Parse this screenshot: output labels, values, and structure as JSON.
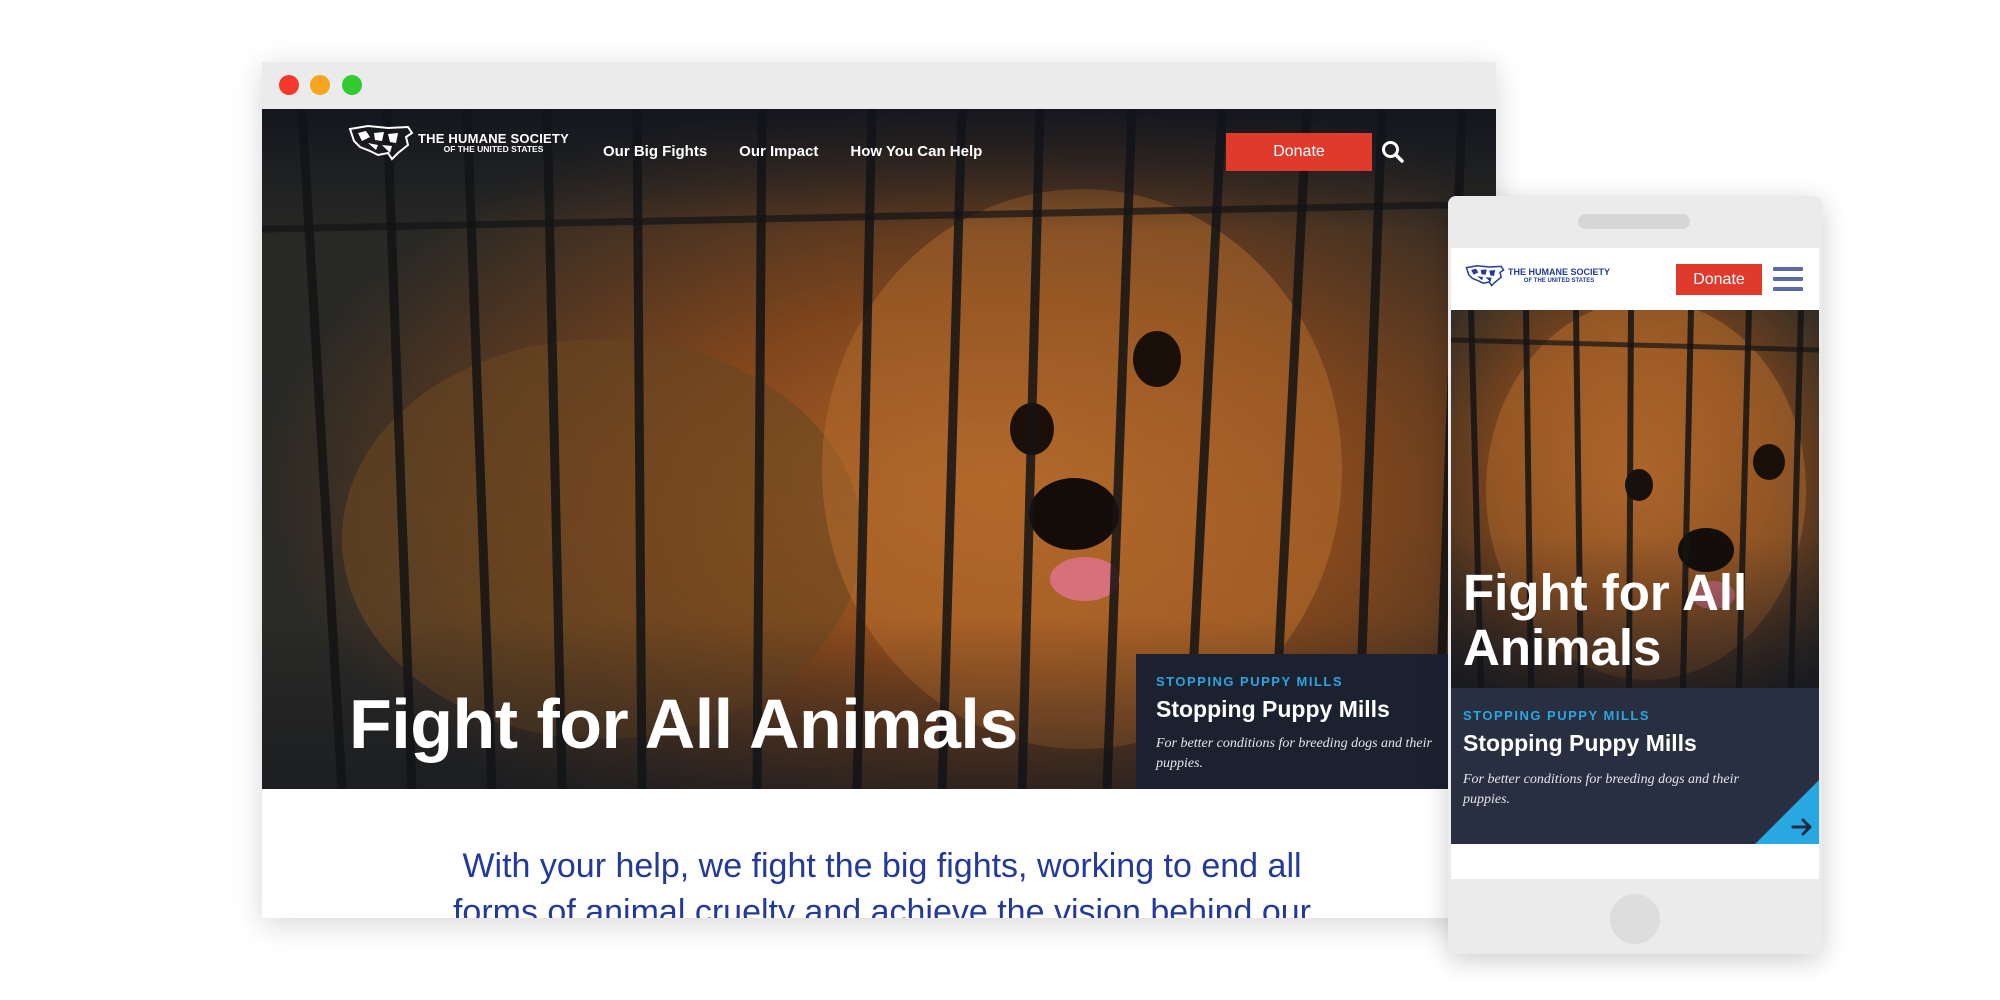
{
  "window_controls": {
    "close": "close",
    "minimize": "minimize",
    "maximize": "maximize"
  },
  "site": {
    "logo_line1": "THE HUMANE SOCIETY",
    "logo_line2": "OF THE UNITED STATES"
  },
  "nav": {
    "links": [
      "Our Big Fights",
      "Our Impact",
      "How You Can Help"
    ],
    "donate_label": "Donate",
    "search_icon": "search-icon"
  },
  "hero": {
    "title": "Fight for All Animals"
  },
  "feature": {
    "eyebrow": "STOPPING PUPPY MILLS",
    "title": "Stopping Puppy Mills",
    "subtitle": "For better conditions for breeding dogs and their puppies."
  },
  "intro": {
    "text": "With your help, we fight the big fights, working to end all forms of animal cruelty and achieve the vision behind our"
  },
  "mobile": {
    "donate_label": "Donate",
    "menu_icon": "hamburger-menu-icon",
    "arrow_icon": "arrow-right-icon",
    "hero_title": "Fight for All Animals"
  },
  "colors": {
    "accent_red": "#e03a2c",
    "accent_blue": "#28a8e0",
    "brand_navy": "#233a9b",
    "feature_bg": "#1c2130"
  }
}
